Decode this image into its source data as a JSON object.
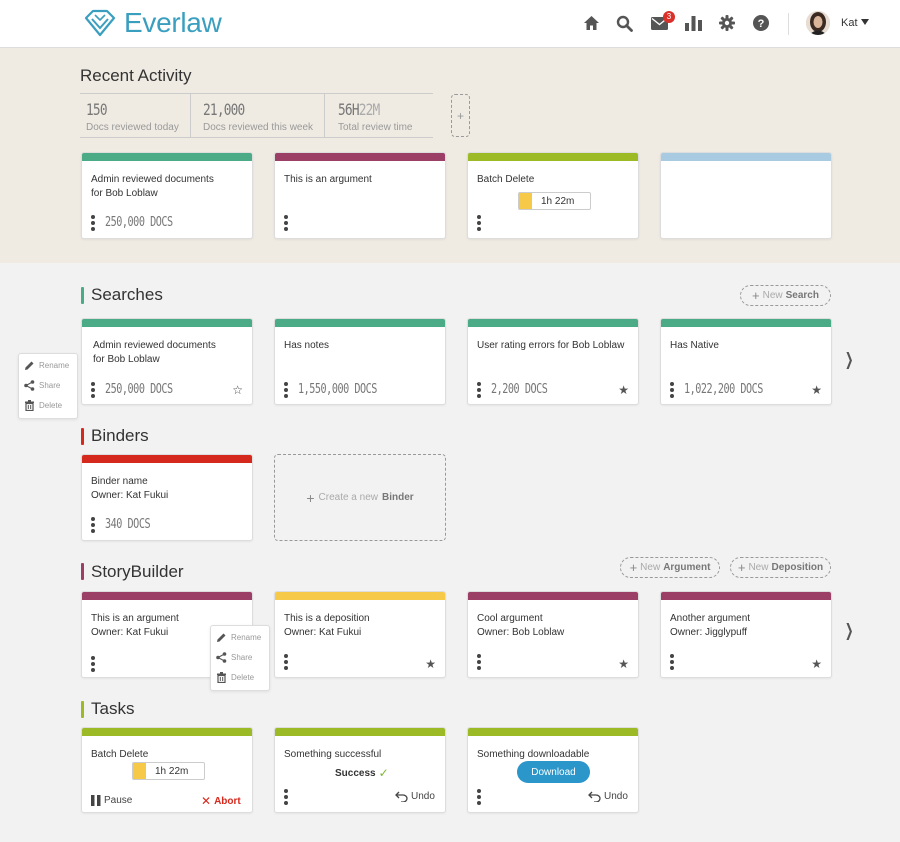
{
  "header": {
    "app_name": "Everlaw",
    "nav_icons": [
      "home-icon",
      "search-icon",
      "mail-icon",
      "chart-icon",
      "gear-icon",
      "help-icon"
    ],
    "mail_badge": "3",
    "user_name": "Kat",
    "brand_color": "#3a9fbf"
  },
  "recent": {
    "title": "Recent Activity",
    "stats": [
      {
        "value": "150",
        "label": "Docs reviewed today"
      },
      {
        "value": "21,000",
        "label": "Docs reviewed this week"
      },
      {
        "value_main": "56H",
        "value_dim": "22M",
        "label": "Total review time"
      }
    ],
    "add_label": "+",
    "cards": [
      {
        "line1": "Admin reviewed documents",
        "line2": "for Bob Loblaw",
        "docs": "250,000 DOCS",
        "color": "#4aab86"
      },
      {
        "line1": "This is an argument",
        "color": "#9c3f67"
      },
      {
        "line1": "Batch Delete",
        "timer": "1h 22m",
        "progress": 0.19,
        "color": "#9cba26"
      },
      {
        "color": "#a9cbe2"
      }
    ]
  },
  "searches": {
    "title": "Searches",
    "color": "#4aab86",
    "new_prefix": "New",
    "new_bold": "Search",
    "cards": [
      {
        "line1": "Admin reviewed documents",
        "line2": "for Bob Loblaw",
        "docs": "250,000 DOCS",
        "starred": false
      },
      {
        "line1": "Has notes",
        "docs": "1,550,000 DOCS"
      },
      {
        "line1": "User rating errors for Bob Loblaw",
        "docs": "2,200 DOCS",
        "starred": true
      },
      {
        "line1": "Has Native",
        "docs": "1,022,200 DOCS",
        "starred": true
      }
    ]
  },
  "context_menu": {
    "rename": "Rename",
    "share": "Share",
    "delete": "Delete"
  },
  "binders": {
    "title": "Binders",
    "color": "#d6291d",
    "cards": [
      {
        "line1": "Binder name",
        "line2": "Owner: Kat Fukui",
        "docs": "340 DOCS"
      }
    ],
    "create_prefix": "Create a new",
    "create_bold": "Binder"
  },
  "storybuilder": {
    "title": "StoryBuilder",
    "color": "#9c3f67",
    "new_prefix": "New",
    "new_argument_bold": "Argument",
    "new_deposition_bold": "Deposition",
    "cards": [
      {
        "line1": "This is an argument",
        "line2": "Owner: Kat Fukui",
        "color": "#9c3f67"
      },
      {
        "line1": "This is a deposition",
        "line2": "Owner: Kat Fukui",
        "color": "#f7c948",
        "starred": true
      },
      {
        "line1": "Cool argument",
        "line2": "Owner: Bob Loblaw",
        "color": "#9c3f67",
        "starred": true
      },
      {
        "line1": "Another argument",
        "line2": "Owner: Jigglypuff",
        "color": "#9c3f67",
        "starred": true
      }
    ]
  },
  "tasks": {
    "title": "Tasks",
    "color": "#9cba26",
    "cards": [
      {
        "line1": "Batch Delete",
        "timer": "1h 22m",
        "progress": 0.19,
        "pause": "Pause",
        "abort": "Abort"
      },
      {
        "line1": "Something successful",
        "status": "Success",
        "undo": "Undo"
      },
      {
        "line1": "Something downloadable",
        "button": "Download",
        "undo": "Undo"
      }
    ]
  }
}
